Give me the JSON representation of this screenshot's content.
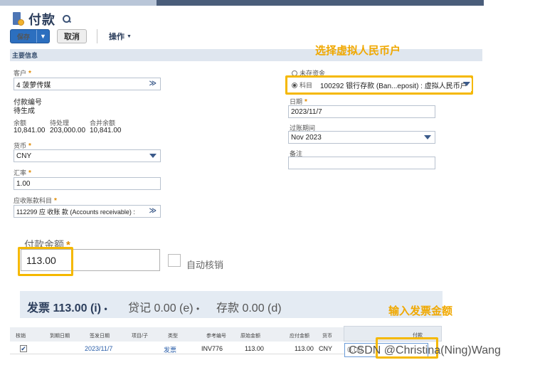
{
  "page": {
    "title": "付款"
  },
  "toolbar": {
    "save_label": "保存",
    "cancel_label": "取消",
    "actions_label": "操作"
  },
  "section": {
    "title": "主要信息"
  },
  "left": {
    "customer": {
      "label": "客户",
      "value": "4 菠萝传媒"
    },
    "payment_no": {
      "label": "付款编号",
      "value": "待生成"
    },
    "balance": {
      "label": "余额",
      "value": "10,841.00"
    },
    "pending": {
      "label": "待处理",
      "value": "203,000.00"
    },
    "consolidated": {
      "label": "合并余额",
      "value": "10,841.00"
    },
    "currency": {
      "label": "货币",
      "value": "CNY"
    },
    "exchange_rate": {
      "label": "汇率",
      "value": "1.00"
    },
    "ar_account": {
      "label": "应收账款科目",
      "value": "112299 应 收账 款 (Accounts receivable) :"
    }
  },
  "right": {
    "undeposited": {
      "label": "未存资金"
    },
    "account": {
      "label": "科目",
      "value": "100292 银行存款 (Ban...eposit) : 虚拟人民币户"
    },
    "date": {
      "label": "日期",
      "value": "2023/11/7"
    },
    "posting_period": {
      "label": "过账期间",
      "value": "Nov 2023"
    },
    "memo": {
      "label": "备注",
      "value": ""
    }
  },
  "annotations": {
    "select_account": "选择虚拟人民币户",
    "enter_amount": "输入发票金额"
  },
  "payment": {
    "amount_label": "付款金额",
    "amount_value": "113.00",
    "auto_apply_label": "自动核销"
  },
  "tabs": [
    {
      "label": "发票 113.00 (i)",
      "suffix": "•"
    },
    {
      "label": "贷记 0.00 (e)",
      "suffix": "•"
    },
    {
      "label": "存款 0.00 (d)",
      "suffix": ""
    }
  ],
  "grid": {
    "headers": [
      "核销",
      "到期日期",
      "签发日期",
      "项目/子",
      "类型",
      "参考编号",
      "原始金额",
      "应付金额",
      "货币",
      "付款"
    ],
    "rows": [
      {
        "apply": "✔",
        "due": "",
        "issued": "2023/11/7",
        "project": "",
        "type": "发票",
        "ref": "INV776",
        "orig": "113.00",
        "due_amt": "113.00",
        "currency": "CNY",
        "payment": "0.00"
      }
    ]
  },
  "watermark": "CSDN @Christina(Ning)Wang",
  "colors": {
    "accent": "#2c6fbf",
    "highlight": "#f5b800",
    "annotation": "#f0a800"
  }
}
